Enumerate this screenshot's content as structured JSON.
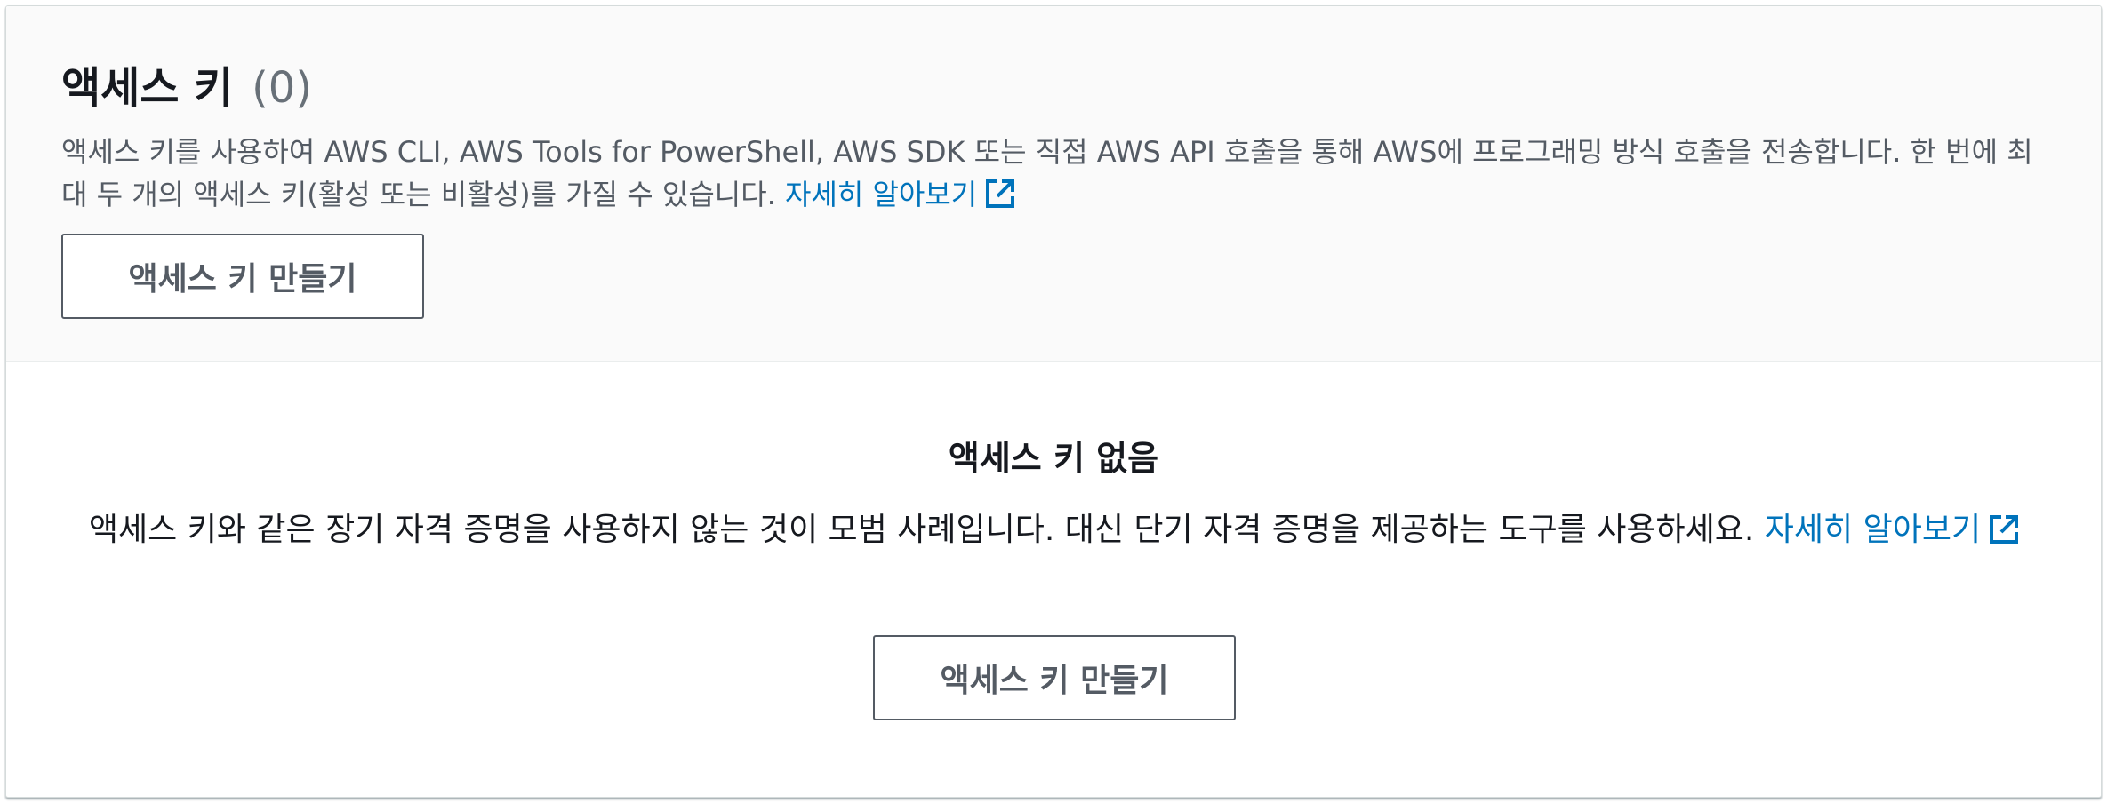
{
  "header": {
    "title": "액세스 키",
    "count": "(0)",
    "description": "액세스 키를 사용하여 AWS CLI, AWS Tools for PowerShell, AWS SDK 또는 직접 AWS API 호출을 통해 AWS에 프로그래밍 방식 호출을 전송합니다. 한 번에 최대 두 개의 액세스 키(활성 또는 비활성)를 가질 수 있습니다.",
    "learn_more": "자세히 알아보기",
    "create_button": "액세스 키 만들기"
  },
  "empty_state": {
    "title": "액세스 키 없음",
    "description": "액세스 키와 같은 장기 자격 증명을 사용하지 않는 것이 모범 사례입니다. 대신 단기 자격 증명을 제공하는 도구를 사용하세요.",
    "learn_more": "자세히 알아보기",
    "create_button": "액세스 키 만들기"
  },
  "colors": {
    "link": "#0073bb",
    "text": "#16191f",
    "secondary_text": "#545b64",
    "header_bg": "#fafafa"
  },
  "icons": {
    "external_link": "external-link-icon"
  }
}
